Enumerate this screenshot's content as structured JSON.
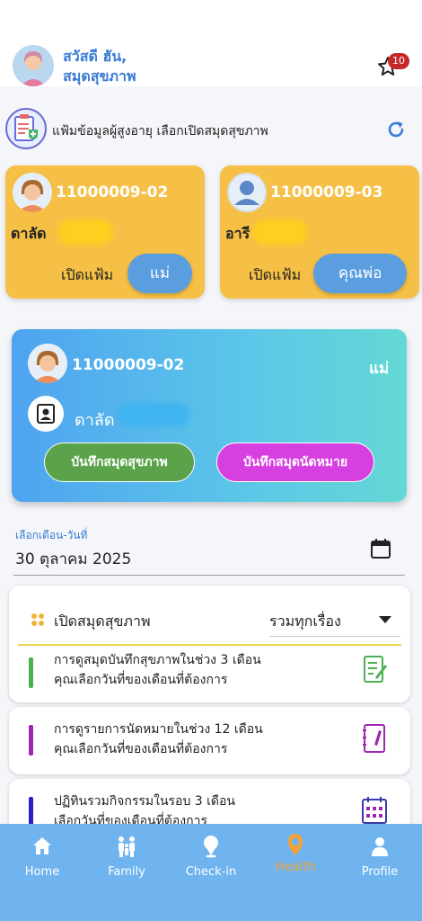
{
  "header": {
    "greeting_line1": "สวัสดี ฮัน,",
    "greeting_line2": "สมุดสุขภาพ",
    "favorites_icon": "star-icon",
    "notification_count": "10"
  },
  "section": {
    "title": "แฟ้มข้อมูลผู้สูงอายุ เลือกเปิดสมุดสุขภาพ",
    "refresh_icon": "refresh-icon"
  },
  "patients": [
    {
      "id": "11000009-02",
      "name": "ดาลัด",
      "open_label": "เปิดแฟ้ม",
      "relation": "แม่",
      "avatar": "elderly-woman-avatar"
    },
    {
      "id": "11000009-03",
      "name": "อารี",
      "open_label": "เปิดแฟ้ม",
      "relation": "คุณพ่อ",
      "avatar": "default-user-avatar"
    }
  ],
  "selected_patient": {
    "id": "11000009-02",
    "relation": "แม่",
    "name": "ดาลัด",
    "health_record_button": "บันทึกสมุดสุขภาพ",
    "appointment_button": "บันทึกสมุดนัดหมาย"
  },
  "date_picker": {
    "label": "เลือกเดือน-วันที่",
    "value": "30 ตุลาคม 2025"
  },
  "filter": {
    "label": "เปิดสมุดสุขภาพ",
    "selected": "รวมทุกเรื่อง"
  },
  "items": [
    {
      "line1": "การดูสมุดบันทึกสุขภาพในช่วง 3 เดือน",
      "line2": "คุณเลือกวันที่ของเดือนที่ต้องการ",
      "color": "#4caf50",
      "icon": "notebook-pen-icon"
    },
    {
      "line1": "การดูรายการนัดหมายในช่วง 12 เดือน",
      "line2": "คุณเลือกวันที่ของเดือนที่ต้องการ",
      "color": "#9c27b0",
      "icon": "planner-pen-icon"
    },
    {
      "line1": "ปฏิทินรวมกิจกรรมในรอบ 3 เดือน",
      "line2": "เลือกวันที่ของเดือนที่ต้องการ",
      "color": "#2a1fc7",
      "icon": "calendar-grid-icon"
    }
  ],
  "nav": [
    {
      "label": "Home",
      "icon": "home-icon",
      "active": false
    },
    {
      "label": "Family",
      "icon": "family-icon",
      "active": false
    },
    {
      "label": "Check-in",
      "icon": "location-icon",
      "active": false
    },
    {
      "label": "Health",
      "icon": "health-shield-icon",
      "active": true
    },
    {
      "label": "Profile",
      "icon": "profile-icon",
      "active": false
    }
  ],
  "colors": {
    "accent_blue": "#3a7bd5",
    "card_yellow": "#f5c045",
    "nav_bg": "#6fb4ef",
    "nav_active": "#f0a23a",
    "health_button": "#5aa34a",
    "appointment_button": "#d63fe0"
  }
}
